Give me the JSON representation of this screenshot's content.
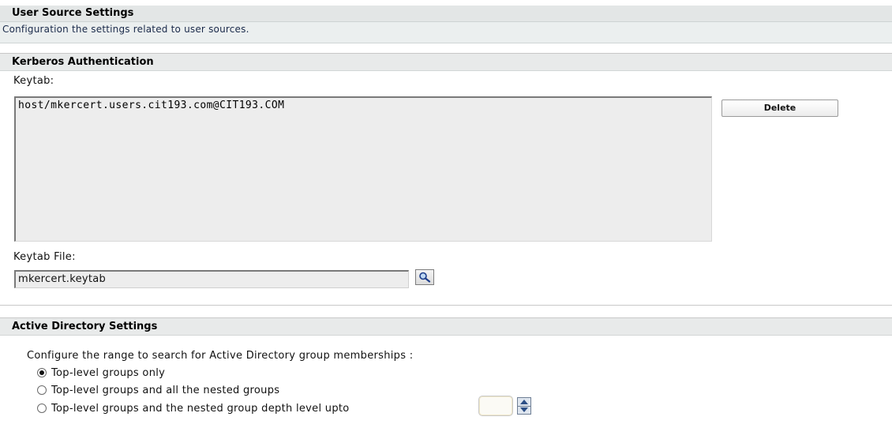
{
  "user_source": {
    "title": "User Source Settings",
    "description": "Configuration the settings related to user sources."
  },
  "kerberos": {
    "title": "Kerberos Authentication",
    "keytab_label": "Keytab:",
    "keytab_entries": [
      "host/mkercert.users.cit193.com@CIT193.COM"
    ],
    "delete_label": "Delete",
    "keytab_file_label": "Keytab File:",
    "keytab_file_value": "mkercert.keytab",
    "browse_icon": "magnifier-icon"
  },
  "active_directory": {
    "title": "Active Directory Settings",
    "description": "Configure the range to search for Active Directory group memberships :",
    "options": [
      {
        "label": "Top-level groups only",
        "checked": true
      },
      {
        "label": "Top-level groups and all the nested groups",
        "checked": false
      },
      {
        "label": "Top-level groups and the nested group depth level upto",
        "checked": false
      }
    ],
    "depth_value": "",
    "spinner_icons": [
      "arrow-up-icon",
      "arrow-down-icon"
    ]
  },
  "colors": {
    "header_bg": "#e8eaea",
    "section_bg": "#ebefef",
    "field_bg": "#ededed",
    "description_text": "#1a2a4a"
  }
}
